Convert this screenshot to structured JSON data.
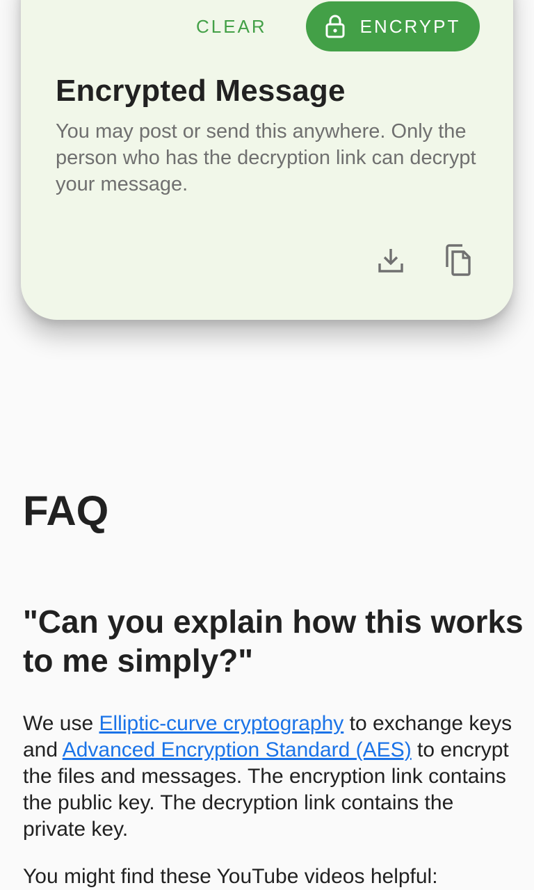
{
  "card": {
    "clear_label": "CLEAR",
    "encrypt_label": "ENCRYPT",
    "title": "Encrypted Message",
    "description": "You may post or send this anywhere. Only the person who has the decryption link can decrypt your message.",
    "download_icon": "download-icon",
    "copy_icon": "copy-icon",
    "lock_icon": "lock-icon"
  },
  "faq": {
    "title": "FAQ",
    "question": "\"Can you explain how this works to me simply?\"",
    "answer": {
      "part1": "We use ",
      "link1": "Elliptic-curve cryptography",
      "part2": " to exchange keys and ",
      "link2": "Advanced Encryption Standard (AES)",
      "part3": " to encrypt the files and messages. The encryption link contains the public key. The decryption link contains the private key."
    },
    "videos_intro": "You might find these YouTube videos helpful:"
  },
  "colors": {
    "accent": "#43a047",
    "card_bg": "#f1f7e9",
    "link": "#1a73e8"
  }
}
